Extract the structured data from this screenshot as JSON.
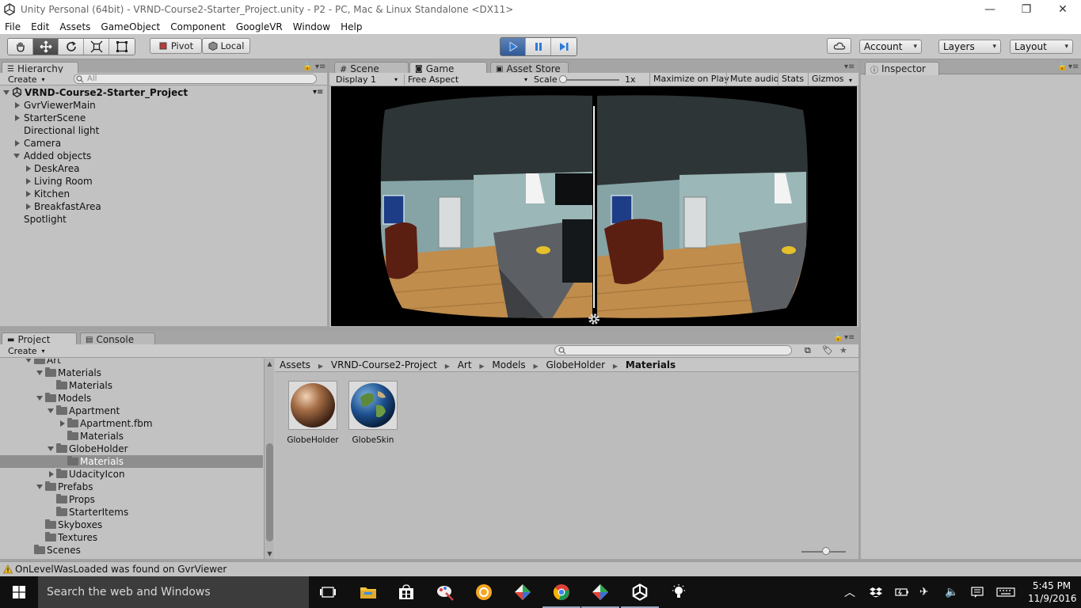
{
  "window": {
    "title": "Unity Personal (64bit) - VRND-Course2-Starter_Project.unity - P2 - PC, Mac & Linux Standalone <DX11>",
    "minimize": "—",
    "maximize": "❐",
    "close": "✕"
  },
  "menu": [
    "File",
    "Edit",
    "Assets",
    "GameObject",
    "Component",
    "GoogleVR",
    "Window",
    "Help"
  ],
  "toolbar": {
    "pivot": "Pivot",
    "local": "Local",
    "account": "Account",
    "layers": "Layers",
    "layout": "Layout"
  },
  "hierarchy": {
    "tab": "Hierarchy",
    "create": "Create",
    "search_placeholder": "All",
    "scene": "VRND-Course2-Starter_Project",
    "items": [
      {
        "label": "GvrViewerMain"
      },
      {
        "label": "StarterScene"
      },
      {
        "label": "Directional light"
      },
      {
        "label": "Camera"
      },
      {
        "label": "Added objects"
      },
      {
        "label": "DeskArea"
      },
      {
        "label": "Living Room"
      },
      {
        "label": "Kitchen"
      },
      {
        "label": "BreakfastArea"
      },
      {
        "label": "Spotlight"
      }
    ]
  },
  "center": {
    "tabs": [
      "Scene",
      "Game",
      "Asset Store"
    ],
    "display": "Display 1",
    "aspect": "Free Aspect",
    "scale_label": "Scale",
    "scale_value": "1x",
    "maximize": "Maximize on Play",
    "mute": "Mute audio",
    "stats": "Stats",
    "gizmos": "Gizmos"
  },
  "inspector": {
    "tab": "Inspector"
  },
  "project": {
    "tabs": [
      "Project",
      "Console"
    ],
    "create": "Create",
    "tree": [
      {
        "label": "Art"
      },
      {
        "label": "Materials"
      },
      {
        "label": "Materials"
      },
      {
        "label": "Models"
      },
      {
        "label": "Apartment"
      },
      {
        "label": "Apartment.fbm"
      },
      {
        "label": "Materials"
      },
      {
        "label": "GlobeHolder"
      },
      {
        "label": "Materials"
      },
      {
        "label": "UdacityIcon"
      },
      {
        "label": "Prefabs"
      },
      {
        "label": "Props"
      },
      {
        "label": "StarterItems"
      },
      {
        "label": "Skyboxes"
      },
      {
        "label": "Textures"
      },
      {
        "label": "Scenes"
      }
    ],
    "breadcrumb": [
      "Assets",
      "VRND-Course2-Project",
      "Art",
      "Models",
      "GlobeHolder",
      "Materials"
    ],
    "assets": [
      {
        "name": "GlobeHolder"
      },
      {
        "name": "GlobeSkin"
      }
    ]
  },
  "status": {
    "message": "OnLevelWasLoaded was found on GvrViewer"
  },
  "taskbar": {
    "search": "Search the web and Windows",
    "time": "5:45 PM",
    "date": "11/9/2016"
  }
}
